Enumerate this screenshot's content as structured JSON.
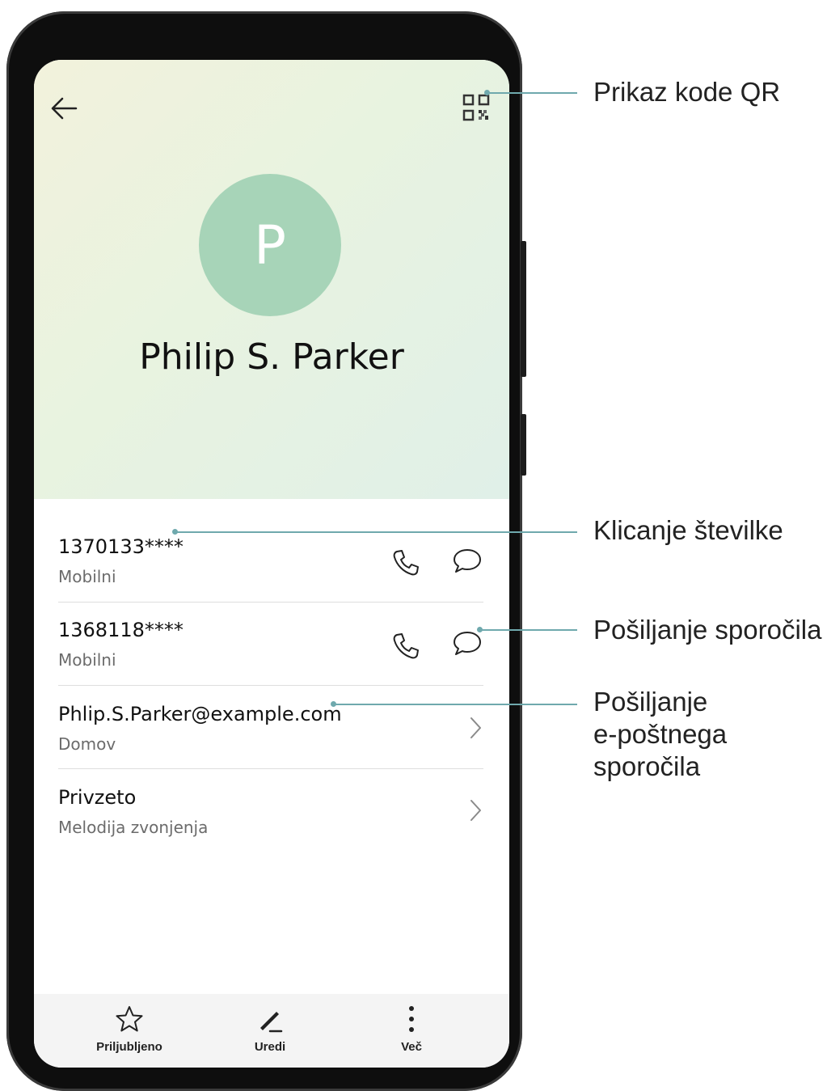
{
  "contact": {
    "avatar_initial": "P",
    "name": "Philip S. Parker",
    "avatar_color": "#a7d4b8"
  },
  "details": [
    {
      "value": "1370133****",
      "type": "Mobilni"
    },
    {
      "value": "1368118****",
      "type": "Mobilni"
    },
    {
      "value": "Phlip.S.Parker@example.com",
      "type": "Domov"
    },
    {
      "value": "Privzeto",
      "type": "Melodija zvonjenja"
    }
  ],
  "bottom_bar": {
    "favorite_label": "Priljubljeno",
    "edit_label": "Uredi",
    "more_label": "Več"
  },
  "callouts": {
    "qr": "Prikaz kode QR",
    "call": "Klicanje številke",
    "message": "Pošiljanje sporočila",
    "email_line1": "Pošiljanje",
    "email_line2": "e-poštnega",
    "email_line3": "sporočila"
  },
  "icons": [
    "back-arrow-icon",
    "qr-code-icon",
    "phone-icon",
    "message-bubble-icon",
    "chevron-right-icon",
    "star-icon",
    "pencil-icon",
    "more-vertical-icon"
  ],
  "colors": {
    "callout_line": "#6fa9ad",
    "header_gradient_start": "#f2f2dc",
    "header_gradient_end": "#e0f0e8"
  }
}
